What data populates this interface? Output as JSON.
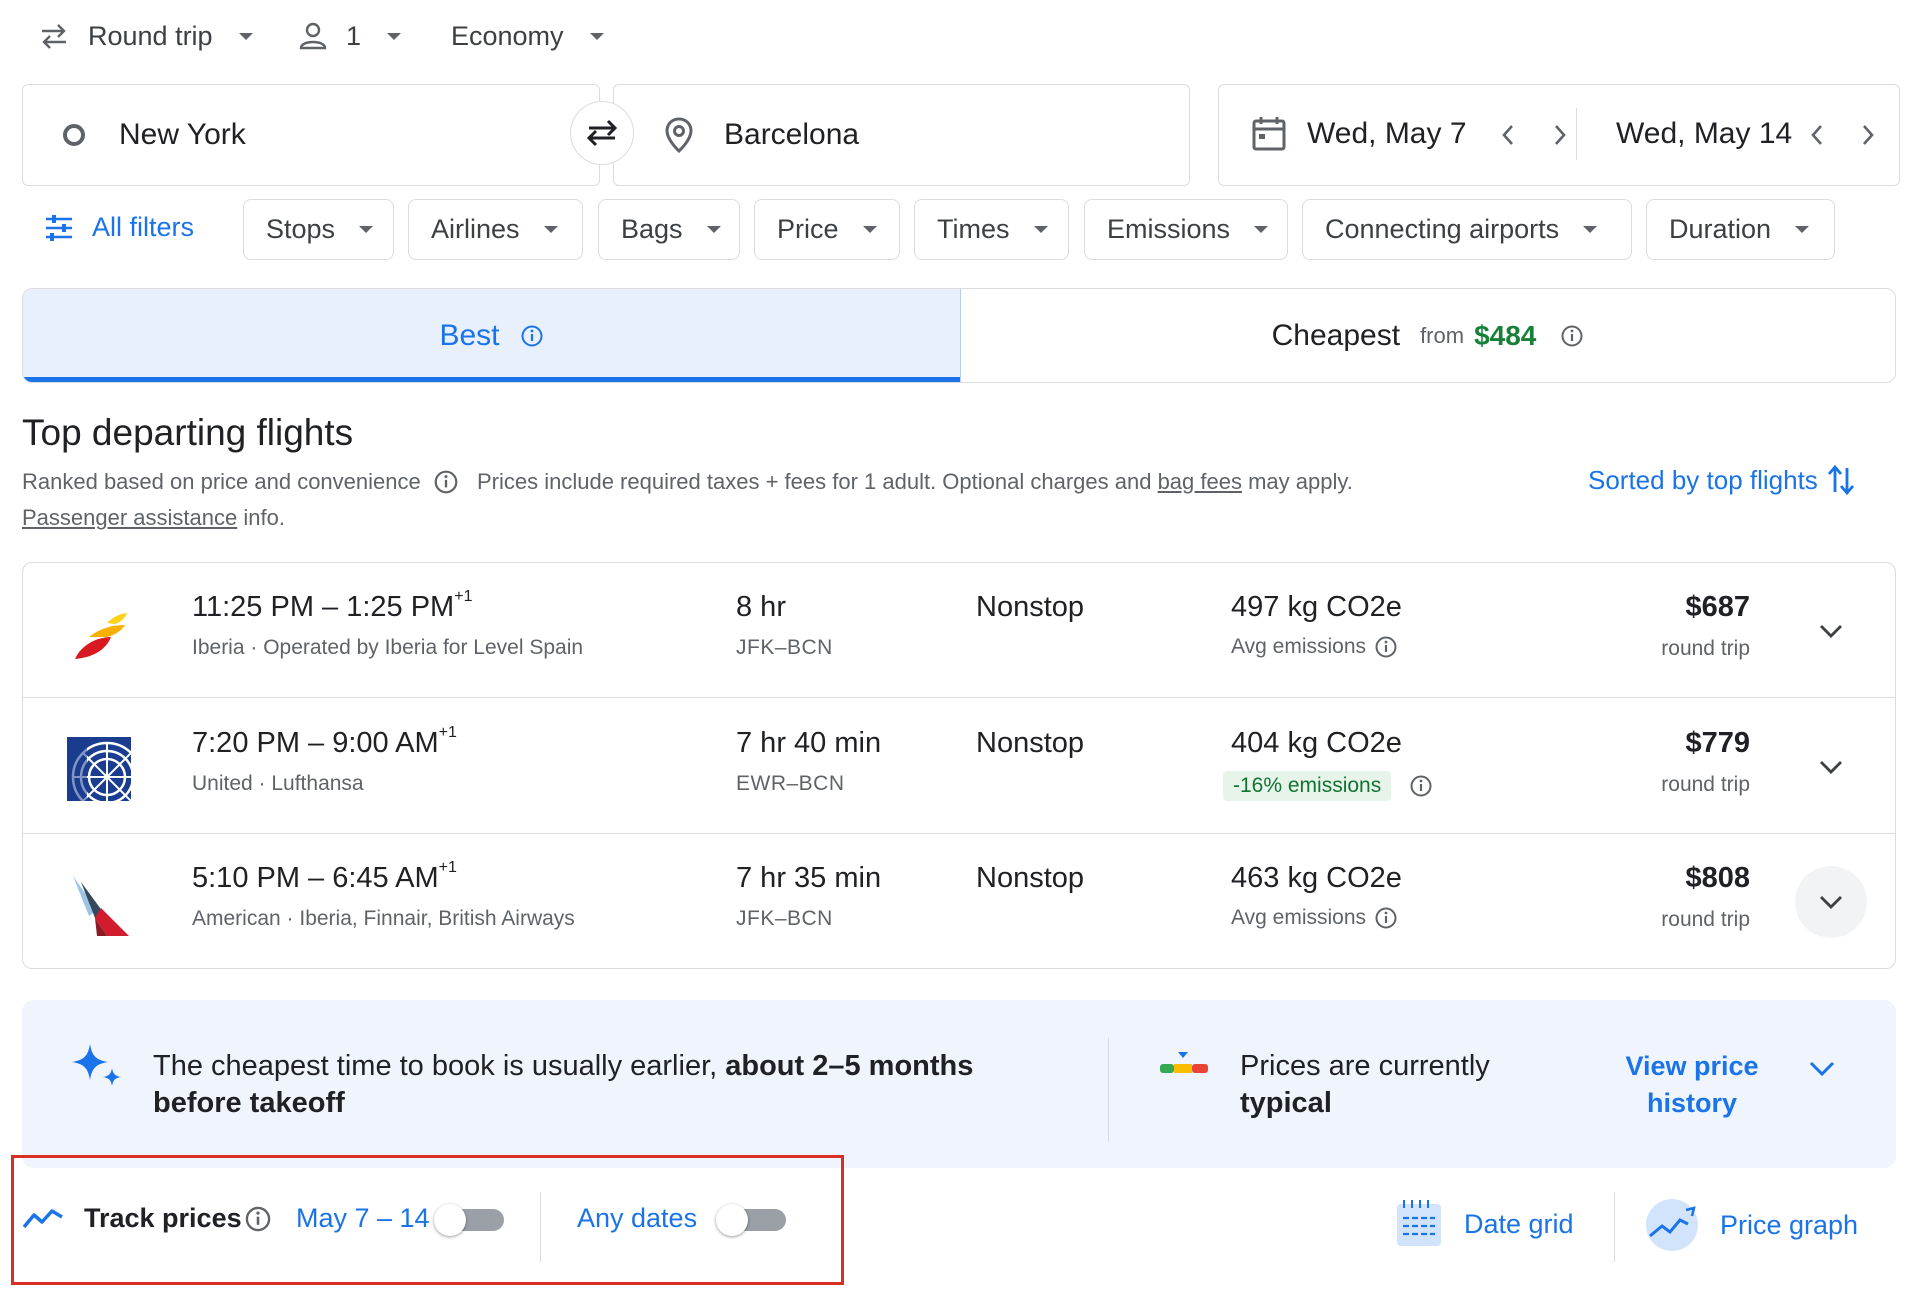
{
  "search": {
    "trip_type": "Round trip",
    "passengers": "1",
    "cabin_class": "Economy",
    "origin": "New York",
    "destination": "Barcelona",
    "depart_date": "Wed, May 7",
    "return_date": "Wed, May 14"
  },
  "filters": {
    "all_filters": "All filters",
    "chips": [
      "Stops",
      "Airlines",
      "Bags",
      "Price",
      "Times",
      "Emissions",
      "Connecting airports",
      "Duration"
    ]
  },
  "tabs": {
    "best": "Best",
    "cheapest": "Cheapest",
    "cheapest_from": "from",
    "cheapest_price": "$484"
  },
  "results": {
    "title": "Top departing flights",
    "ranked_text": "Ranked based on price and convenience",
    "prices_text_a": "Prices include required taxes + fees for 1 adult. Optional charges and",
    "bag_fees": "bag fees",
    "prices_text_b": "may apply.",
    "passenger_assistance": "Passenger assistance",
    "info_text": "info.",
    "sorted_by": "Sorted by top flights"
  },
  "flights": [
    {
      "times": "11:25 PM – 1:25 PM",
      "day_offset": "+1",
      "airline": "Iberia · Operated by Iberia for Level Spain",
      "duration": "8 hr",
      "route": "JFK–BCN",
      "stops": "Nonstop",
      "co2": "497 kg CO2e",
      "emissions": "Avg emissions",
      "price": "$687",
      "price_type": "round trip",
      "logo": "iberia-logo"
    },
    {
      "times": "7:20 PM – 9:00 AM",
      "day_offset": "+1",
      "airline": "United · Lufthansa",
      "duration": "7 hr 40 min",
      "route": "EWR–BCN",
      "stops": "Nonstop",
      "co2": "404 kg CO2e",
      "emissions": "-16% emissions",
      "price": "$779",
      "price_type": "round trip",
      "logo": "united-logo"
    },
    {
      "times": "5:10 PM – 6:45 AM",
      "day_offset": "+1",
      "airline": "American · Iberia, Finnair, British Airways",
      "duration": "7 hr 35 min",
      "route": "JFK–BCN",
      "stops": "Nonstop",
      "co2": "463 kg CO2e",
      "emissions": "Avg emissions",
      "price": "$808",
      "price_type": "round trip",
      "logo": "american-logo"
    }
  ],
  "insights": {
    "book_text": "The cheapest time to book is usually earlier,",
    "book_bold": "about 2–5 months before takeoff",
    "typical_text": "Prices are currently",
    "typical_bold": "typical",
    "view_history": "View price history"
  },
  "tracking": {
    "track_prices": "Track prices",
    "date_range": "May 7 – 14",
    "any_dates": "Any dates",
    "date_grid": "Date grid",
    "price_graph": "Price graph",
    "date_range_on": false,
    "any_dates_on": false
  },
  "colors": {
    "accent": "#1a73e8",
    "green": "#188038",
    "highlight_box": "#d93025"
  }
}
